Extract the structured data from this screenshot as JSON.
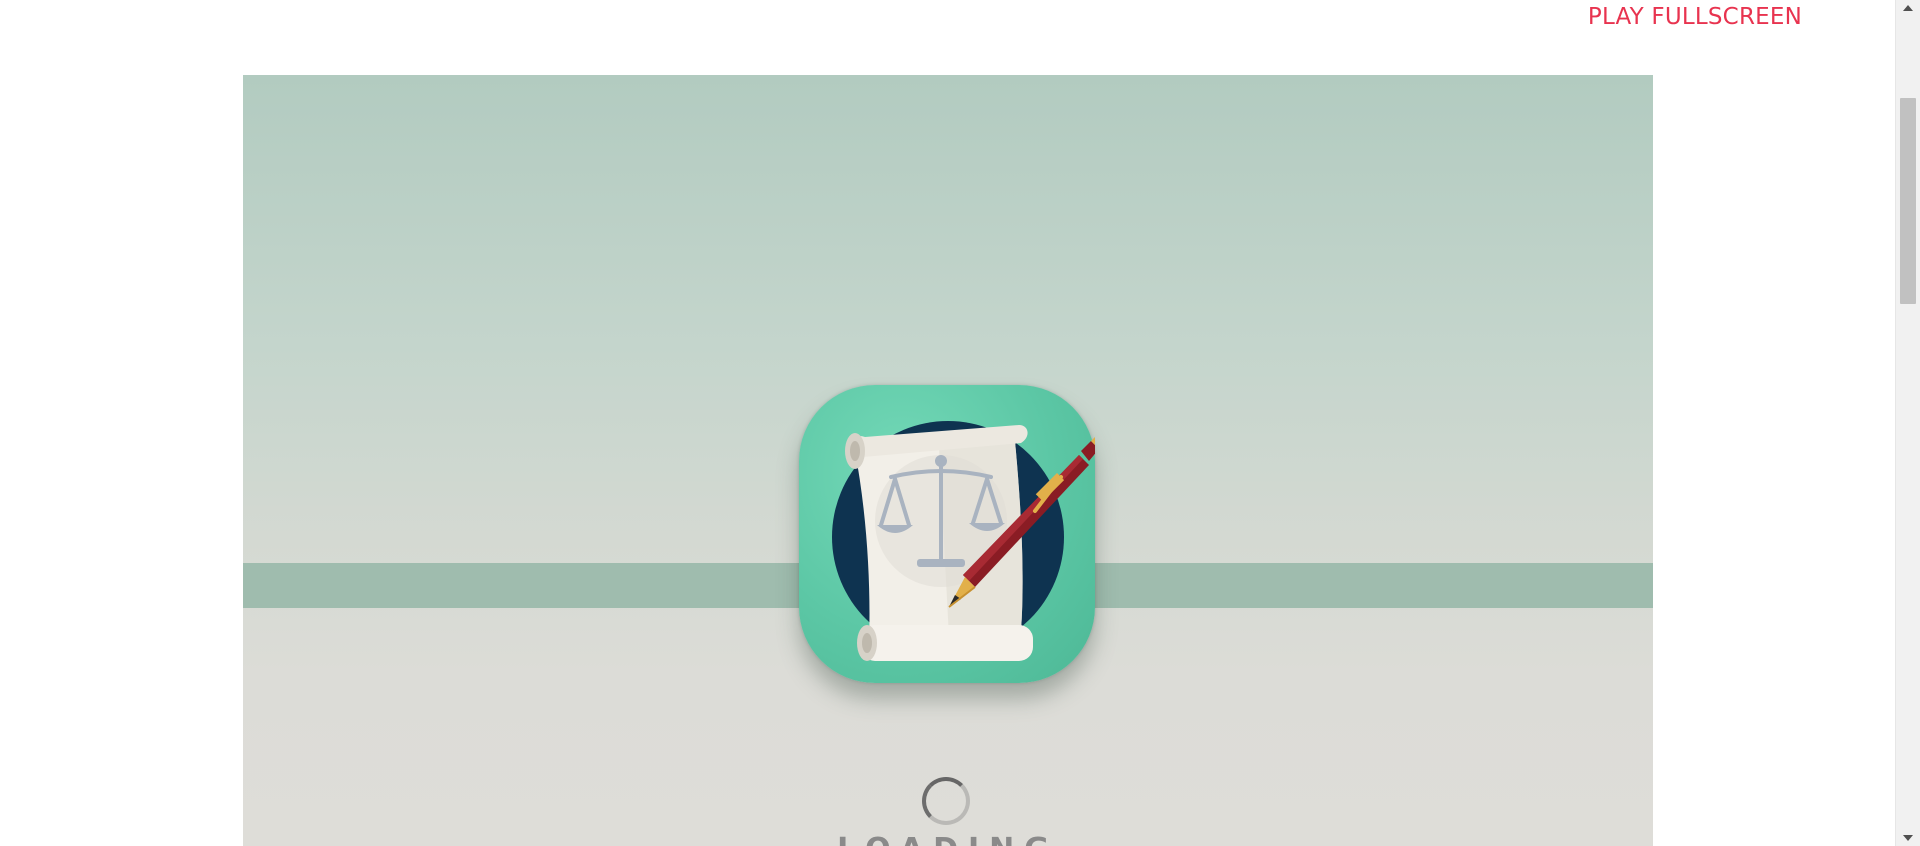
{
  "header": {
    "fullscreen_label": "PLAY FULLSCREEN"
  },
  "game": {
    "loading_text": "LOADING",
    "icon": "legal-scroll-scales-pen-icon"
  },
  "colors": {
    "accent": "#e8334f",
    "icon_bg": "#5cc7a5",
    "icon_circle": "#0e3350",
    "pen": "#8a1c24"
  }
}
